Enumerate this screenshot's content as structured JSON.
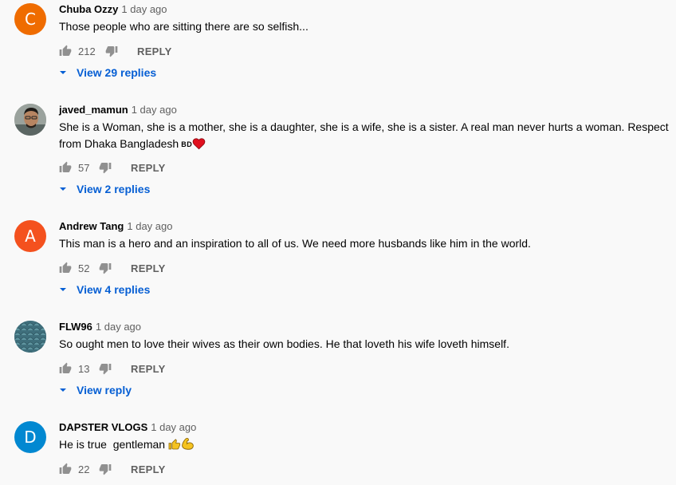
{
  "comments": [
    {
      "author": "Chuba Ozzy",
      "time": "1 day ago",
      "avatar_letter": "C",
      "avatar_color": "#ef6c00",
      "text": "Those people who are sitting there are so selfish...",
      "likes": "212",
      "reply_label": "REPLY",
      "view_replies_label": "View 29 replies"
    },
    {
      "author": "javed_mamun",
      "time": "1 day ago",
      "avatar_letter": "",
      "avatar_color": "#8a8f8c",
      "text": "She is a Woman, she is a mother, she is a daughter, she is a wife, she is a sister. A real man never hurts a woman. Respect from Dhaka Bangladesh",
      "text_suffix": "BD",
      "emoji": "red-heart",
      "likes": "57",
      "reply_label": "REPLY",
      "view_replies_label": "View 2 replies"
    },
    {
      "author": "Andrew Tang",
      "time": "1 day ago",
      "avatar_letter": "A",
      "avatar_color": "#f4511e",
      "text": "This man is a hero and an inspiration to all of us. We need more husbands like him in the world.",
      "likes": "52",
      "reply_label": "REPLY",
      "view_replies_label": "View 4 replies"
    },
    {
      "author": "FLW96",
      "time": "1 day ago",
      "avatar_letter": "",
      "avatar_color": "#4a7a86",
      "text": "So ought men to love their wives as their own bodies. He that loveth his wife loveth himself.",
      "likes": "13",
      "reply_label": "REPLY",
      "view_replies_label": "View reply"
    },
    {
      "author": "DAPSTER VLOGS",
      "time": "1 day ago",
      "avatar_letter": "D",
      "avatar_color": "#0288d1",
      "text": "He is true  gentleman",
      "emoji": "thumbs-up-flexed-biceps",
      "likes": "22",
      "reply_label": "REPLY"
    }
  ],
  "colors": {
    "background": "#f9f9f9",
    "link_blue": "#065fd4",
    "secondary_text": "#606060"
  }
}
